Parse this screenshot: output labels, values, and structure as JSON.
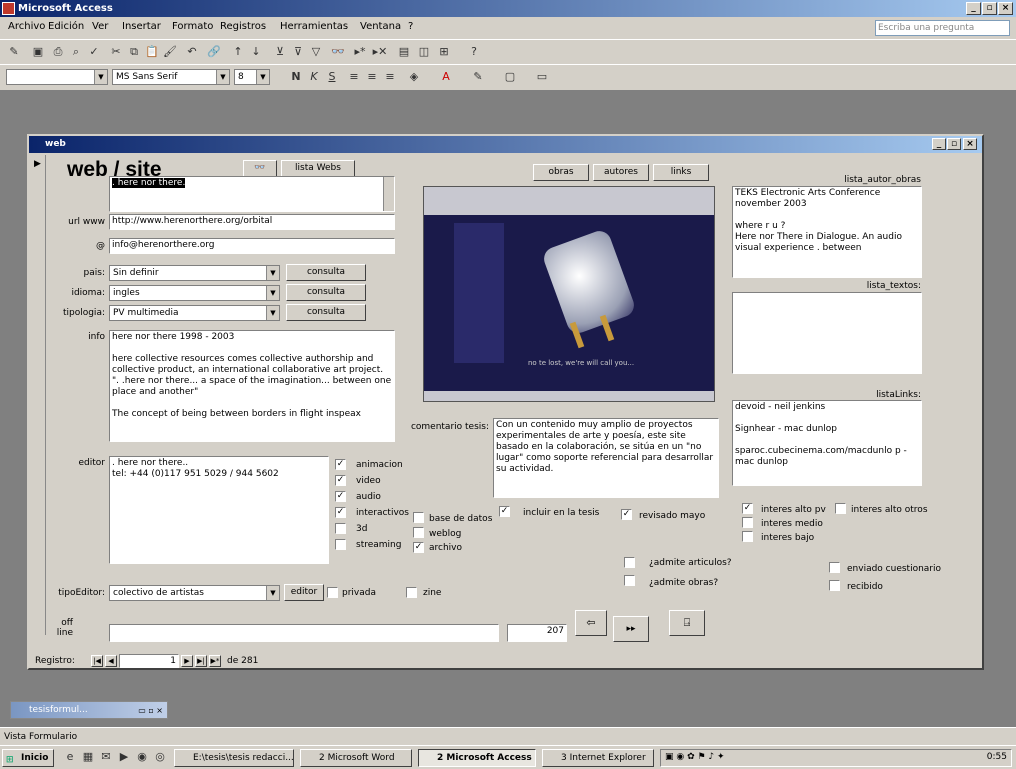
{
  "app": {
    "title": "Microsoft Access"
  },
  "menu": [
    "Archivo",
    "Edición",
    "Ver",
    "Insertar",
    "Formato",
    "Registros",
    "Herramientas",
    "Ventana",
    "?"
  ],
  "ask_placeholder": "Escriba una pregunta",
  "format_toolbar": {
    "font": "MS Sans Serif",
    "size": "8"
  },
  "form": {
    "title": "web",
    "heading": "web / site",
    "lista_webs_btn": "lista Webs",
    "name_value": ". here nor there.",
    "url_label": "url www",
    "url_value": "http://www.herenorthere.org/orbital",
    "email_label": "@",
    "email_value": "info@herenorthere.org",
    "pais_label": "pais:",
    "pais_value": "Sin definir",
    "idioma_label": "idioma:",
    "idioma_value": "ingles",
    "tipologia_label": "tipologia:",
    "tipologia_value": "PV multimedia",
    "consulta_btn": "consulta",
    "info_label": "info",
    "info_value": "here nor there 1998 - 2003\n\nhere collective resources comes collective authorship and collective product, an international collaborative art project.\n\". .here nor there... a space of the imagination... between one place and another\"\n\nThe concept of being between borders in flight inspeax",
    "editor_label": "editor",
    "editor_value": ". here nor there..\ntel: +44 (0)117 951 5029 / 944 5602",
    "checks_media": [
      {
        "label": "animacion",
        "checked": true
      },
      {
        "label": "video",
        "checked": true
      },
      {
        "label": "audio",
        "checked": true
      },
      {
        "label": "interactivos",
        "checked": true
      },
      {
        "label": "3d",
        "checked": false
      },
      {
        "label": "streaming",
        "checked": false
      }
    ],
    "checks_more": [
      {
        "label": "base de datos",
        "checked": false
      },
      {
        "label": "weblog",
        "checked": false
      },
      {
        "label": "archivo",
        "checked": true
      }
    ],
    "tipoeditor_label": "tipoEditor:",
    "tipoeditor_value": "colectivo de artistas",
    "editor_btn": "editor",
    "privada_label": "privada",
    "zine_label": "zine",
    "offline_label": "off line",
    "offline_number": "207",
    "tabs": [
      "obras",
      "autores",
      "links"
    ],
    "preview_caption": "no te lost, we're will call you...",
    "comentario_label": "comentario tesis:",
    "comentario_value": "Con un contenido muy amplio de proyectos experimentales de arte y poesía, este site basado en la colaboración, se sitúa en un \"no lugar\" como soporte referencial para desarrollar su actividad.",
    "incluir_label": "incluir en la tesis",
    "revisado_label": "revisado mayo",
    "admite_articulos": "¿admite articulos?",
    "admite_obras": "¿admite obras?",
    "lista_autor_obras_label": "lista_autor_obras",
    "lista_autor_obras_value": "TEKS Electronic Arts Conference november 2003\n\nwhere r u ?\nHere nor There in Dialogue. An audio visual experience . between",
    "lista_textos_label": "lista_textos:",
    "listalinks_label": "listaLinks:",
    "listalinks_value": "devoid - neil jenkins\n\nSignhear - mac dunlop\n\nsparoc.cubecinema.com/macdunlo p - mac dunlop",
    "interes": [
      {
        "label": "interes alto pv",
        "checked": true
      },
      {
        "label": "interes alto otros",
        "checked": false
      },
      {
        "label": "interes medio",
        "checked": false
      },
      {
        "label": "interes bajo",
        "checked": false
      }
    ],
    "enviado_label": "enviado cuestionario",
    "recibido_label": "recibido",
    "registro_label": "Registro:",
    "registro_value": "1",
    "registro_total": "de  281"
  },
  "minimized_window": "tesisformul...",
  "status": "Vista Formulario",
  "taskbar": {
    "start": "Inicio",
    "tasks": [
      "E:\\tesis\\tesis redacci...",
      "2 Microsoft Word",
      "2 Microsoft Access",
      "3 Internet Explorer"
    ],
    "clock": "0:55"
  }
}
